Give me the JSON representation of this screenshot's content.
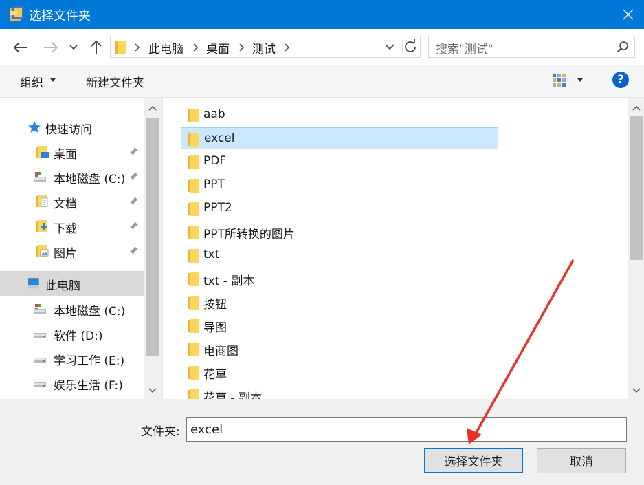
{
  "window": {
    "title": "选择文件夹",
    "accent": "#0078d7"
  },
  "address": {
    "crumbs": [
      "此电脑",
      "桌面",
      "测试"
    ]
  },
  "search": {
    "placeholder": "搜索\"测试\""
  },
  "toolbar": {
    "organize": "组织",
    "new_folder": "新建文件夹"
  },
  "nav": {
    "quick_access": "快速访问",
    "quick_items": [
      {
        "label": "桌面",
        "icon": "desktop-folder-icon"
      },
      {
        "label": "本地磁盘 (C:)",
        "icon": "drive-icon"
      },
      {
        "label": "文档",
        "icon": "documents-folder-icon"
      },
      {
        "label": "下载",
        "icon": "downloads-folder-icon"
      },
      {
        "label": "图片",
        "icon": "pictures-folder-icon"
      }
    ],
    "this_pc": "此电脑",
    "pc_items": [
      {
        "label": "本地磁盘 (C:)",
        "icon": "system-drive-icon"
      },
      {
        "label": "软件 (D:)",
        "icon": "drive-icon"
      },
      {
        "label": "学习工作 (E:)",
        "icon": "drive-icon"
      },
      {
        "label": "娱乐生活 (F:)",
        "icon": "drive-icon"
      }
    ]
  },
  "files": [
    {
      "name": "aab"
    },
    {
      "name": "excel",
      "selected": true
    },
    {
      "name": "PDF"
    },
    {
      "name": "PPT"
    },
    {
      "name": "PPT2"
    },
    {
      "name": "PPT所转换的图片"
    },
    {
      "name": "txt"
    },
    {
      "name": "txt - 副本"
    },
    {
      "name": "按钮"
    },
    {
      "name": "导图"
    },
    {
      "name": "电商图"
    },
    {
      "name": "花草"
    },
    {
      "name": "花草 - 副本"
    }
  ],
  "bottom": {
    "folder_label": "文件夹:",
    "folder_value": "excel",
    "select_button": "选择文件夹",
    "cancel_button": "取消"
  },
  "annotation": {
    "arrow_color": "#e8312a"
  }
}
